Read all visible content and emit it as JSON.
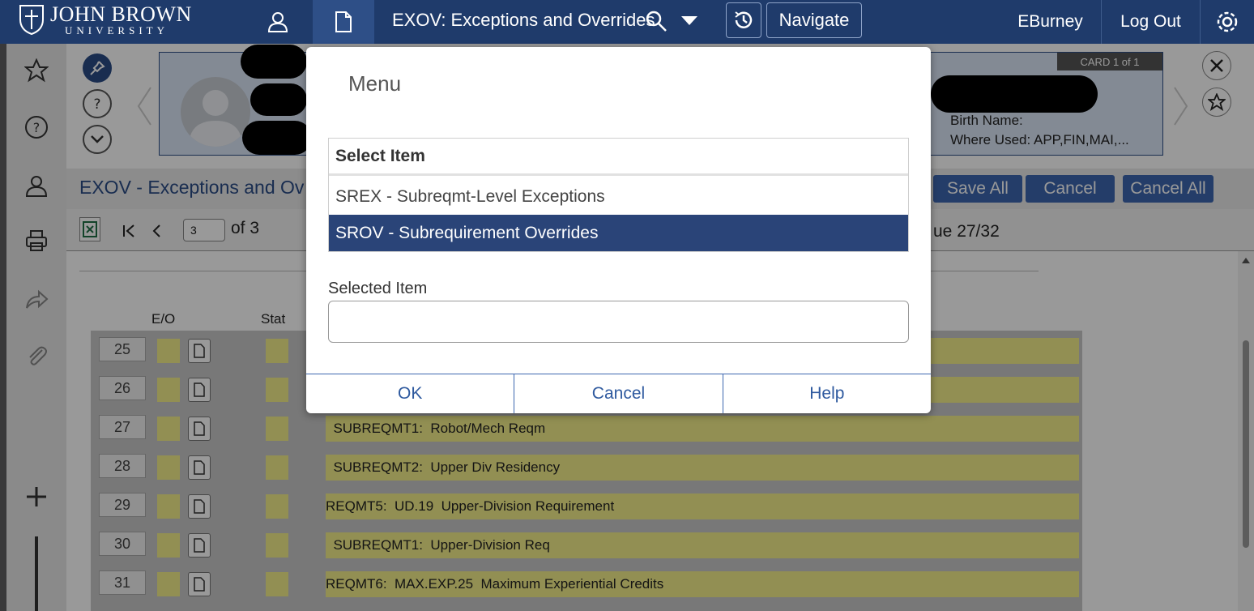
{
  "header": {
    "logo_name": "JOHN BROWN",
    "logo_sub": "UNIVERSITY",
    "form_title": "EXOV: Exceptions and Overrides",
    "navigate_label": "Navigate",
    "username": "EBurney",
    "logout_label": "Log Out"
  },
  "card": {
    "tag": "CARD 1 of 1",
    "birth_name_label": "Birth Name:",
    "where_used_label": "Where Used: APP,FIN,MAI,..."
  },
  "title_row": {
    "heading": "EXOV - Exceptions and Ov",
    "save_all": "Save All",
    "cancel": "Cancel",
    "cancel_all": "Cancel All"
  },
  "nav_row": {
    "page_value": "3",
    "of_label": "of 3",
    "issue_label": "ue 27/32"
  },
  "grid": {
    "columns": {
      "eo": "E/O",
      "stat": "Stat"
    },
    "rows": [
      {
        "num": "25",
        "desc": ""
      },
      {
        "num": "26",
        "desc": ""
      },
      {
        "num": "27",
        "desc": "  SUBREQMT1:  Robot/Mech Reqm"
      },
      {
        "num": "28",
        "desc": "  SUBREQMT2:  Upper Div Residency"
      },
      {
        "num": "29",
        "desc": "REQMT5:  UD.19  Upper-Division Requirement"
      },
      {
        "num": "30",
        "desc": "  SUBREQMT1:  Upper-Division Req"
      },
      {
        "num": "31",
        "desc": "REQMT6:  MAX.EXP.25  Maximum Experiential Credits"
      }
    ]
  },
  "modal": {
    "title": "Menu",
    "list_header": "Select Item",
    "items": [
      {
        "label": "SREX - Subreqmt-Level Exceptions",
        "selected": false
      },
      {
        "label": "SROV - Subrequirement Overrides",
        "selected": true
      }
    ],
    "selected_label": "Selected Item",
    "selected_value": "",
    "ok": "OK",
    "cancel": "Cancel",
    "help": "Help"
  },
  "colors": {
    "topbar": "#1f3b6b",
    "selected_item": "#2a4478",
    "button_blue": "#3d67b0",
    "row_yellow": "#f3ee8a"
  },
  "icons": [
    "user-icon",
    "document-icon",
    "search-icon",
    "chevron-down-icon",
    "history-icon",
    "gear-icon",
    "star-icon",
    "help-icon",
    "printer-icon",
    "share-icon",
    "paperclip-icon",
    "plus-icon",
    "pin-icon",
    "close-icon",
    "excel-icon"
  ]
}
